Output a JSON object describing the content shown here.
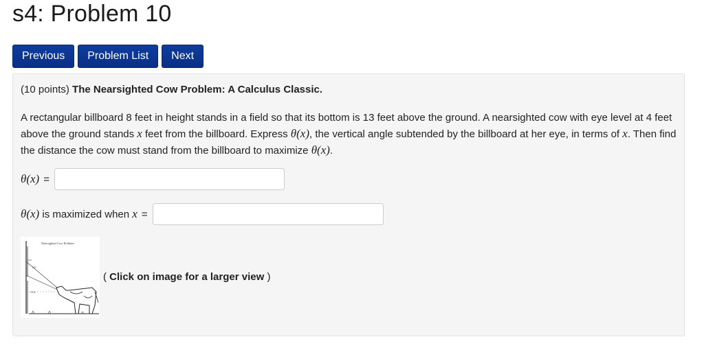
{
  "page": {
    "title": "s4: Problem 10"
  },
  "nav": {
    "previous_label": "Previous",
    "problem_list_label": "Problem List",
    "next_label": "Next"
  },
  "problem": {
    "points": "(10 points)",
    "title": "The Nearsighted Cow Problem: A Calculus Classic.",
    "statement": {
      "part1": "A rectangular billboard 8 feet in height stands in a field so that its bottom is 13 feet above the ground. A nearsighted cow with eye level at 4 feet above the ground stands ",
      "x1": "x",
      "part2": " feet from the billboard. Express ",
      "theta1": "θ(x)",
      "part3": ", the vertical angle subtended by the billboard at her eye, in terms of ",
      "x2": "x",
      "part4": ". Then find the distance the cow must stand from the billboard to maximize ",
      "theta2": "θ(x)",
      "part5": "."
    },
    "answer1": {
      "label": "θ(x)",
      "equals": "=",
      "value": ""
    },
    "answer2": {
      "label": "θ(x)",
      "text": " is maximized when ",
      "var": "x",
      "equals": "=",
      "value": ""
    },
    "image": {
      "caption": "Nearsighted Cow Problem",
      "side_label": "8 ft",
      "low_label": "13 ft"
    },
    "click_note": {
      "open": "(",
      "text": "Click on image for a larger view",
      "close": ")"
    }
  }
}
